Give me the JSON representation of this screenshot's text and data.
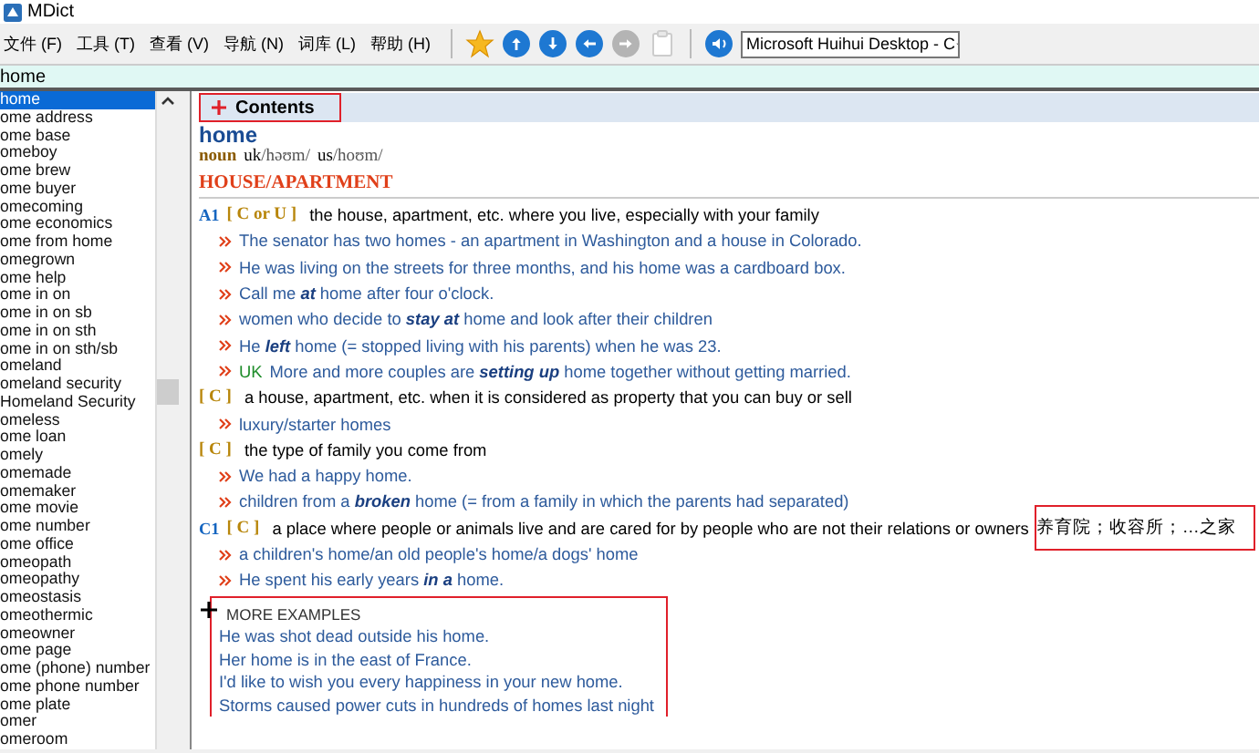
{
  "window": {
    "title": "MDict"
  },
  "menu": [
    {
      "label": "文件 (F)"
    },
    {
      "label": "工具 (T)"
    },
    {
      "label": "查看 (V)"
    },
    {
      "label": "导航 (N)"
    },
    {
      "label": "词库 (L)"
    },
    {
      "label": "帮助 (H)"
    }
  ],
  "toolbar": {
    "buttons": [
      {
        "kind": "star",
        "disabled": false
      },
      {
        "kind": "up",
        "disabled": false
      },
      {
        "kind": "down",
        "disabled": false
      },
      {
        "kind": "back",
        "disabled": false
      },
      {
        "kind": "forward",
        "disabled": true
      },
      {
        "kind": "paste",
        "disabled": true
      },
      {
        "kind": "speak",
        "disabled": false
      }
    ],
    "voice": {
      "value": "Microsoft Huihui Desktop - C"
    }
  },
  "search": {
    "value": "home"
  },
  "word_list": [
    {
      "label": "home",
      "selected": true
    },
    {
      "label": "ome address",
      "selected": false
    },
    {
      "label": "ome base",
      "selected": false
    },
    {
      "label": "omeboy",
      "selected": false
    },
    {
      "label": "ome brew",
      "selected": false
    },
    {
      "label": "ome buyer",
      "selected": false
    },
    {
      "label": "omecoming",
      "selected": false
    },
    {
      "label": "ome economics",
      "selected": false
    },
    {
      "label": "ome from home",
      "selected": false
    },
    {
      "label": "omegrown",
      "selected": false
    },
    {
      "label": "ome help",
      "selected": false
    },
    {
      "label": "ome in on",
      "selected": false
    },
    {
      "label": "ome in on sb",
      "selected": false
    },
    {
      "label": "ome in on sth",
      "selected": false
    },
    {
      "label": "ome in on sth/sb",
      "selected": false
    },
    {
      "label": "omeland",
      "selected": false
    },
    {
      "label": "omeland security",
      "selected": false
    },
    {
      "label": "Homeland Security",
      "selected": false
    },
    {
      "label": "omeless",
      "selected": false
    },
    {
      "label": "ome loan",
      "selected": false
    },
    {
      "label": "omely",
      "selected": false
    },
    {
      "label": "omemade",
      "selected": false
    },
    {
      "label": "omemaker",
      "selected": false
    },
    {
      "label": "ome movie",
      "selected": false
    },
    {
      "label": "ome number",
      "selected": false
    },
    {
      "label": "ome office",
      "selected": false
    },
    {
      "label": "omeopath",
      "selected": false
    },
    {
      "label": "omeopathy",
      "selected": false
    },
    {
      "label": "omeostasis",
      "selected": false
    },
    {
      "label": "omeothermic",
      "selected": false
    },
    {
      "label": "omeowner",
      "selected": false
    },
    {
      "label": "ome page",
      "selected": false
    },
    {
      "label": "ome (phone) number",
      "selected": false
    },
    {
      "label": "ome phone number",
      "selected": false
    },
    {
      "label": "ome plate",
      "selected": false
    },
    {
      "label": "omer",
      "selected": false
    },
    {
      "label": "omeroom",
      "selected": false
    }
  ],
  "entry": {
    "contents": {
      "label": "Contents",
      "highlighted": true
    },
    "headword": "home",
    "pos": "noun",
    "pronunciations": [
      {
        "region": "uk",
        "ipa": "/həʊm/"
      },
      {
        "region": "us",
        "ipa": "/hoʊm/"
      }
    ],
    "section": "HOUSE/APARTMENT",
    "senses": [
      {
        "level": "A1",
        "grammar": "[ C or U ]",
        "definition": "the house, apartment, etc. where you live, especially with your family",
        "examples": [
          {
            "text": "The senator has two homes - an apartment in Washington and a house in Colorado."
          },
          {
            "text": "He was living on the streets for three months, and his home was a cardboard box."
          },
          {
            "text": "Call me **at** home after four o'clock."
          },
          {
            "text": "women who decide to **stay at** home and look after their children"
          },
          {
            "text": "He **left** home (= stopped living with his parents) when he was 23."
          },
          {
            "region": "UK",
            "text": "More and more couples are **setting up** home together without getting married."
          }
        ]
      },
      {
        "grammar": "[ C ]",
        "definition": "a house, apartment, etc. when it is considered as property that you can buy or sell",
        "examples": [
          {
            "text": "luxury/starter homes"
          }
        ]
      },
      {
        "grammar": "[ C ]",
        "definition": "the type of family you come from",
        "examples": [
          {
            "text": "We had a happy home."
          },
          {
            "text": "children from a **broken** home (= from a family in which the parents had separated)"
          }
        ]
      },
      {
        "level": "C1",
        "grammar": "[ C ]",
        "definition": "a place where people or animals live and are cared for by people who are not their relations or owners",
        "translation": {
          "text": "养育院；收容所；…之家",
          "highlighted": true
        },
        "examples": [
          {
            "text": "a children's home/an old people's home/a dogs' home"
          },
          {
            "text": "He spent his early years **in a** home."
          }
        ]
      }
    ],
    "more_examples": {
      "title": "MORE EXAMPLES",
      "highlighted": true,
      "items": [
        "He was shot dead outside his home.",
        "Her home is in the east of France.",
        "I'd like to wish you every happiness in your new home.",
        "Storms caused power cuts in hundreds of homes last night"
      ]
    }
  }
}
